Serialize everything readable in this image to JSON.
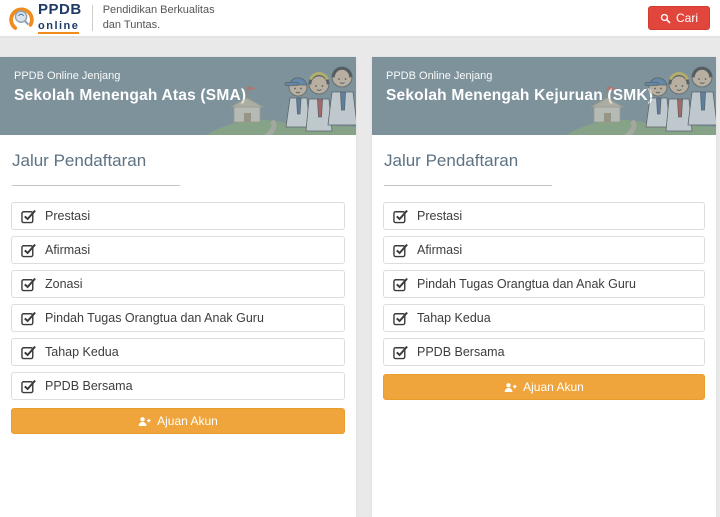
{
  "header": {
    "logo_primary": "PPDB",
    "logo_secondary": "online",
    "tagline_line1": "Pendidikan Berkualitas",
    "tagline_line2": "dan Tuntas.",
    "search_label": "Cari"
  },
  "colors": {
    "search_button_red": "#e0463c",
    "action_button_orange": "#efa43c",
    "banner_slate": "#7e929c",
    "logo_navy": "#1e3a66",
    "logo_orange": "#f08c1e"
  },
  "cards": [
    {
      "banner_label": "PPDB Online Jenjang",
      "title": "Sekolah Menengah Atas (SMA)",
      "section_title": "Jalur Pendaftaran",
      "items": [
        "Prestasi",
        "Afirmasi",
        "Zonasi",
        "Pindah Tugas Orangtua dan Anak Guru",
        "Tahap Kedua",
        "PPDB Bersama"
      ],
      "action_label": "Ajuan Akun"
    },
    {
      "banner_label": "PPDB Online Jenjang",
      "title": "Sekolah Menengah Kejuruan (SMK)",
      "section_title": "Jalur Pendaftaran",
      "items": [
        "Prestasi",
        "Afirmasi",
        "Pindah Tugas Orangtua dan Anak Guru",
        "Tahap Kedua",
        "PPDB Bersama"
      ],
      "action_label": "Ajuan Akun"
    }
  ]
}
